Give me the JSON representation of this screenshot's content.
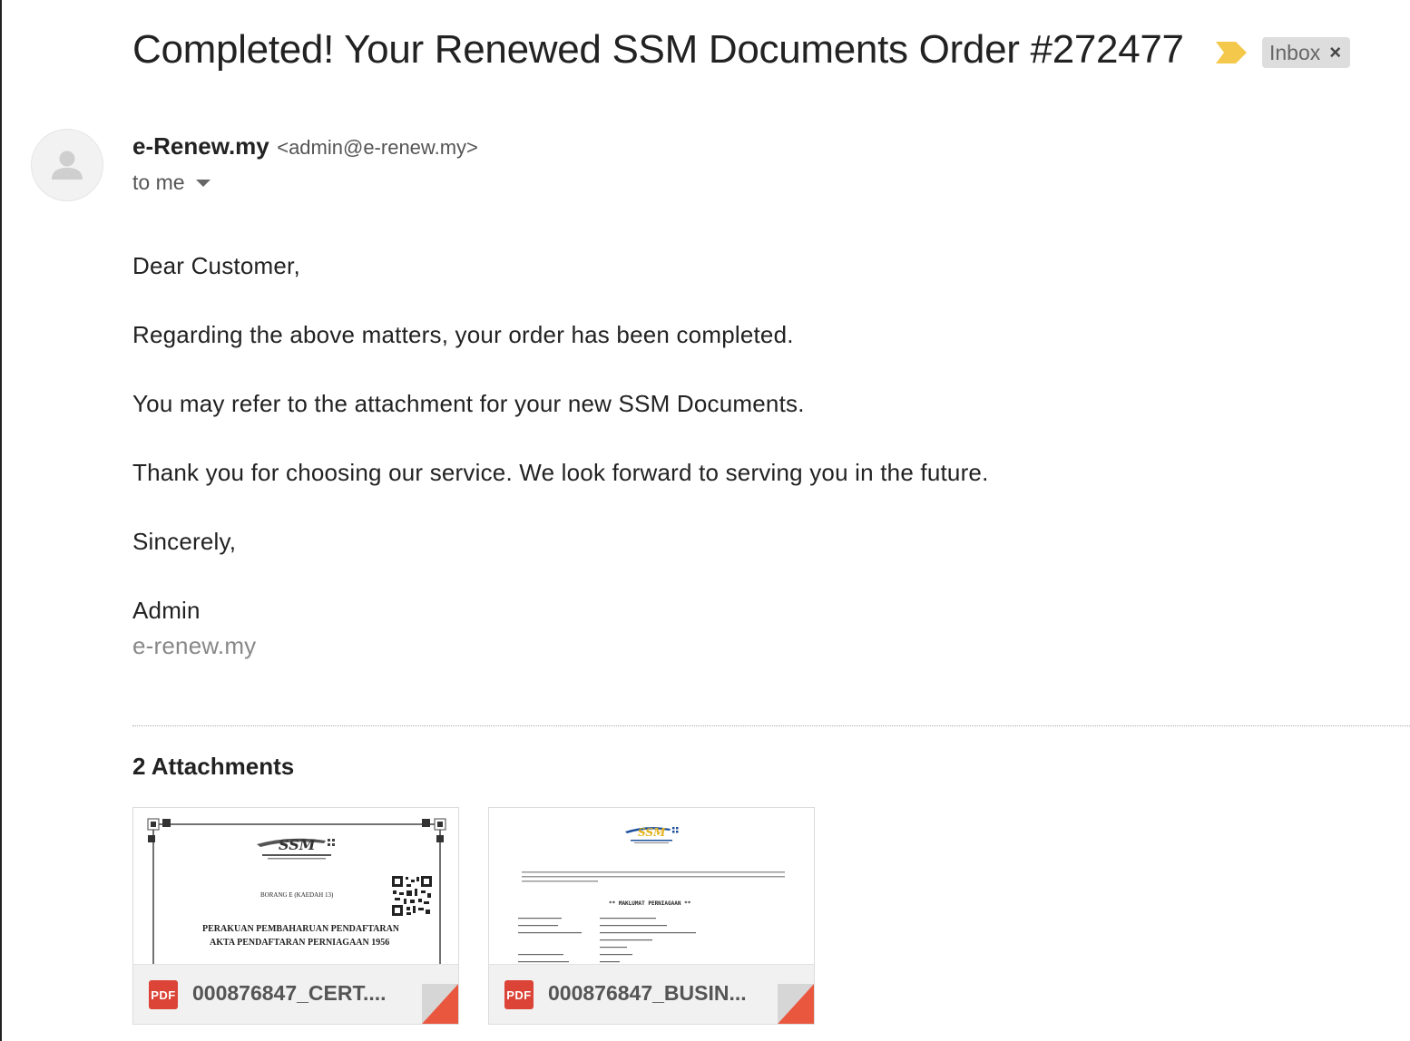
{
  "email": {
    "subject": "Completed! Your Renewed SSM Documents Order #272477",
    "label": "Inbox",
    "label_close": "×",
    "sender_name": "e-Renew.my",
    "sender_email": "<admin@e-renew.my>",
    "recipient": "to me",
    "body": {
      "greeting": "Dear Customer,",
      "line1": "Regarding the above matters, your order has been completed.",
      "line2": "You may refer to the attachment for your new SSM Documents.",
      "line3": "Thank you for choosing our service. We look forward to serving you in the future.",
      "closing": "Sincerely,",
      "signature_name": "Admin",
      "signature_site": "e-renew.my"
    }
  },
  "attachments": {
    "heading": "2 Attachments",
    "items": [
      {
        "badge": "PDF",
        "file_name": "000876847_CERT....",
        "preview": {
          "form_title": "BORANG E (KAEDAH 13)",
          "heading_line1": "PERAKUAN PEMBAHARUAN PENDAFTARAN",
          "heading_line2": "AKTA PENDAFTARAN PERNIAGAAN 1956"
        }
      },
      {
        "badge": "PDF",
        "file_name": "000876847_BUSIN...",
        "preview": {
          "section_title": "** MAKLUMAT PERNIAGAAN **"
        }
      }
    ]
  },
  "colors": {
    "importance_marker": "#f4c84a",
    "pdf_badge": "#db4437",
    "corner_fold": "#e9573f"
  }
}
